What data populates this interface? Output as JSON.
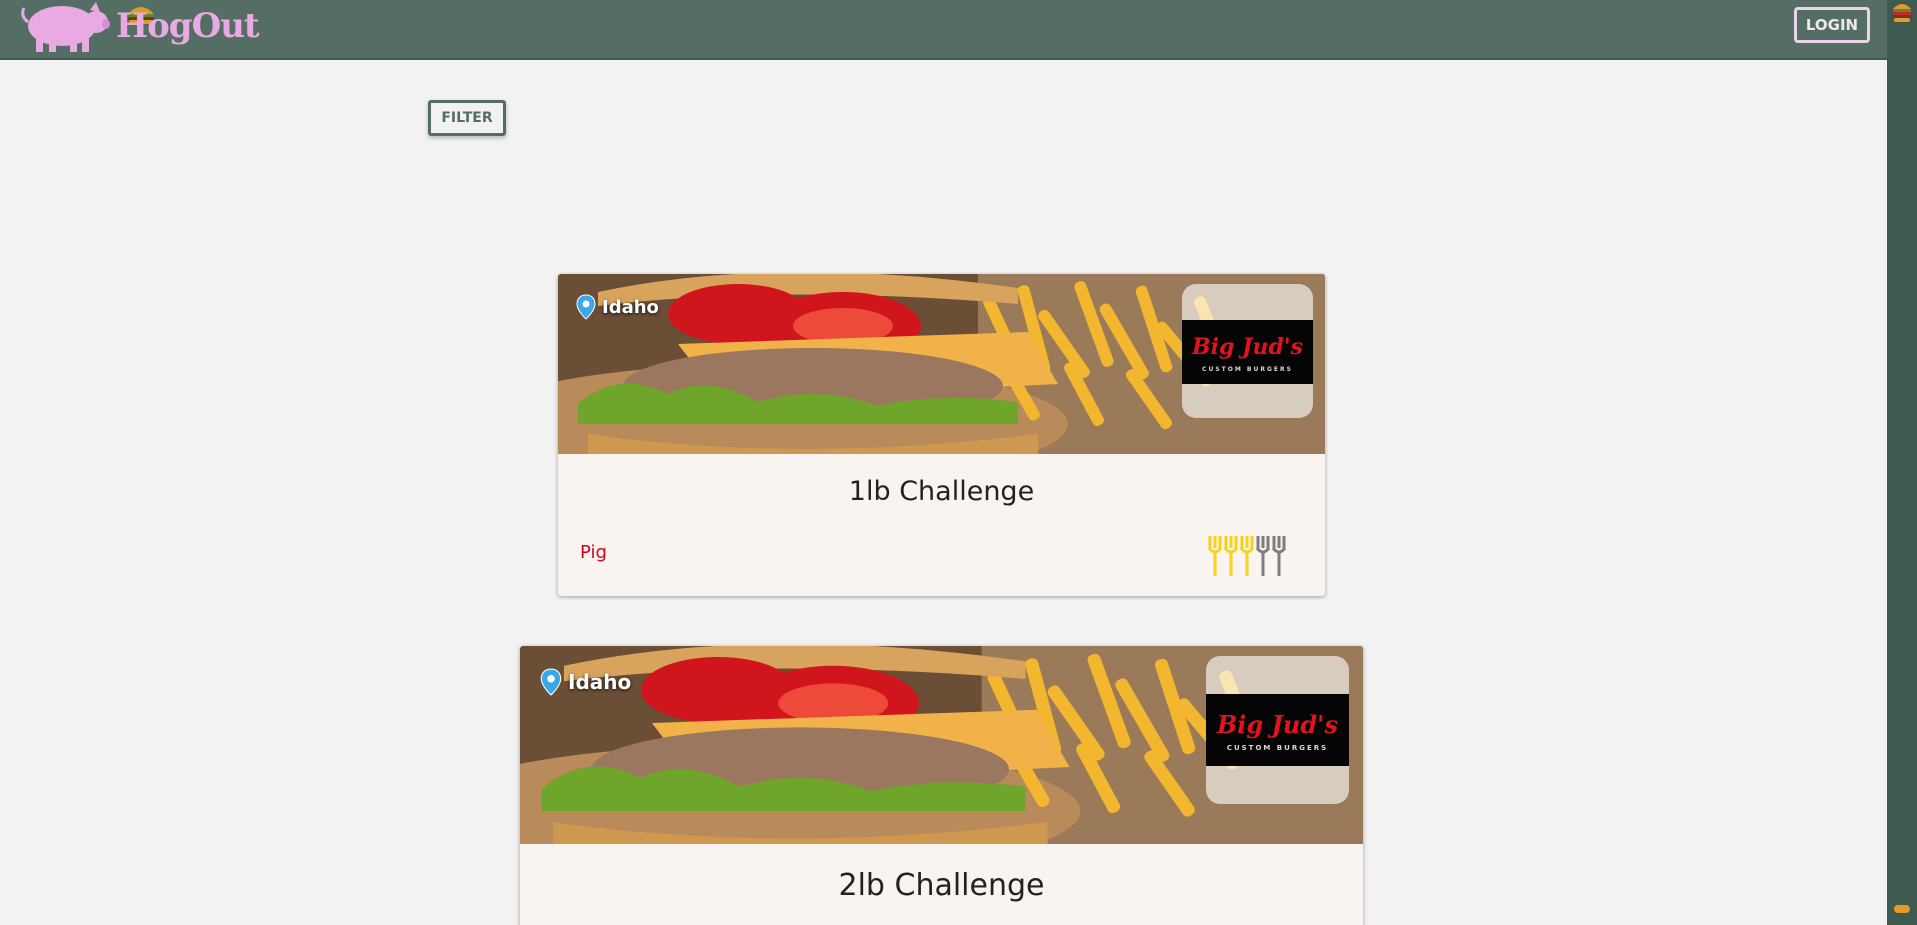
{
  "app": {
    "name": "HogOut"
  },
  "header": {
    "login_label": "LOGIN"
  },
  "toolbar": {
    "filter_label": "FILTER"
  },
  "challenges": [
    {
      "location": "Idaho",
      "brand": "Big Jud's",
      "brand_sub": "CUSTOM BURGERS",
      "title": "1lb Challenge",
      "tier": "Pig",
      "rating": 3,
      "rating_max": 5
    },
    {
      "location": "Idaho",
      "brand": "Big Jud's",
      "brand_sub": "CUSTOM BURGERS",
      "title": "2lb Challenge"
    }
  ],
  "colors": {
    "nav": "#546e64",
    "accent_pink": "#e9a9e3",
    "tier_red": "#d0021b",
    "fork_on": "#f5d21c",
    "fork_off": "#7d7d7d"
  }
}
